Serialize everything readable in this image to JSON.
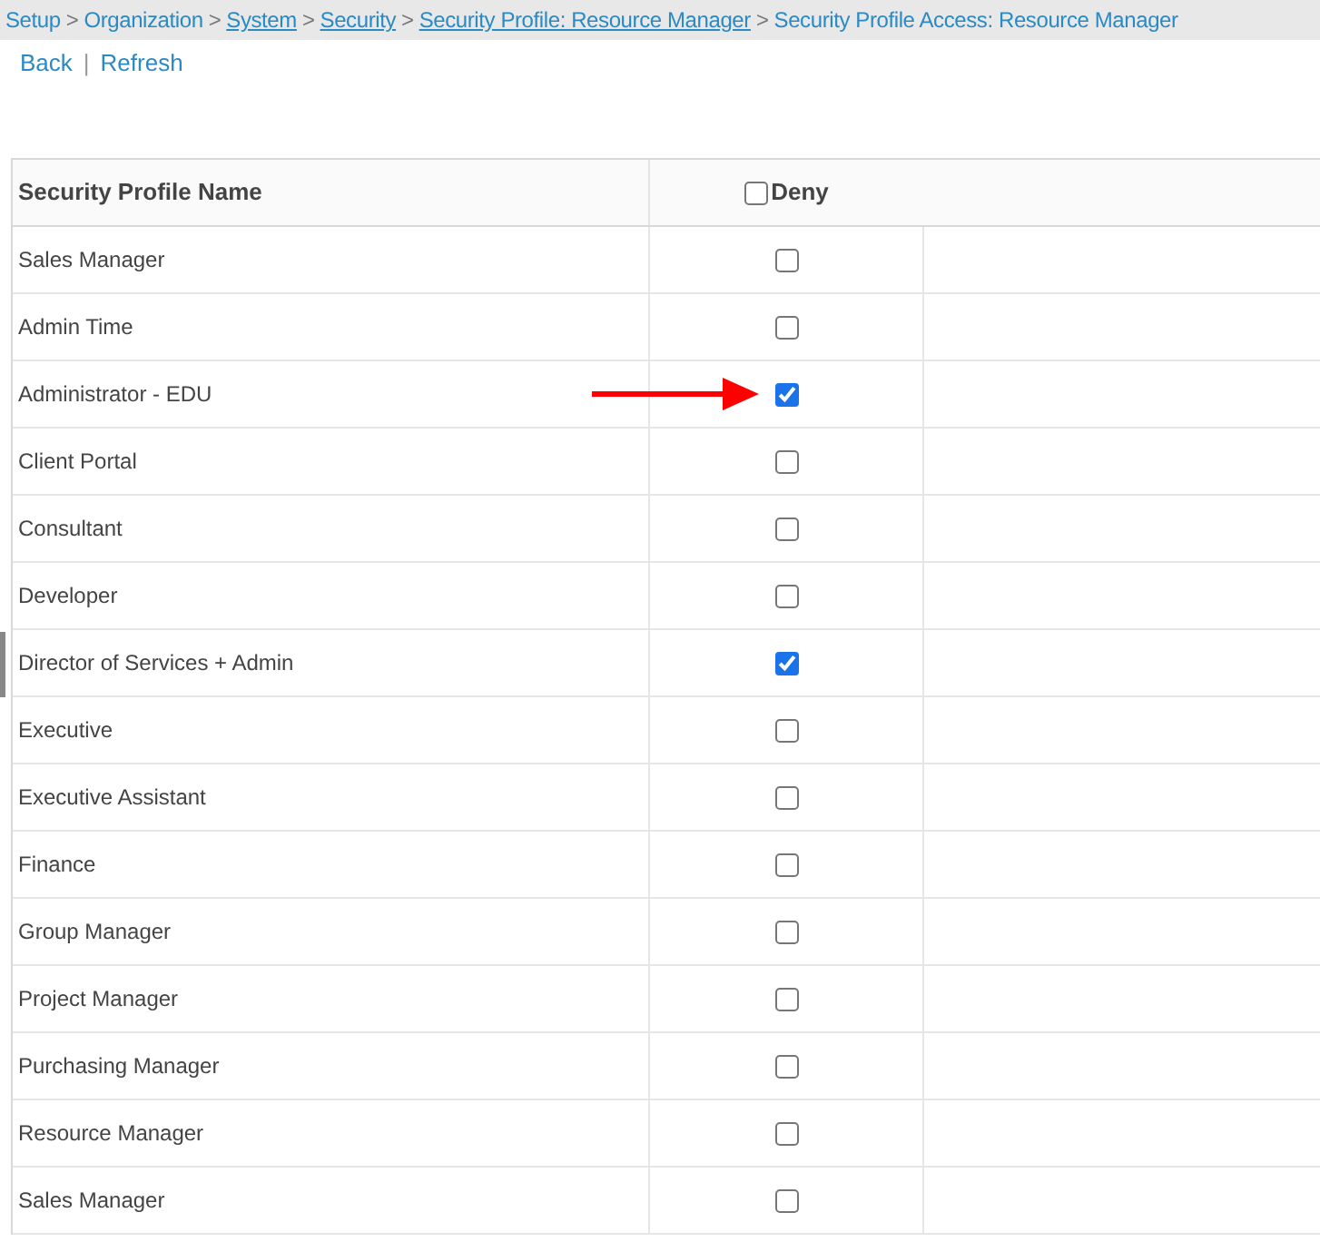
{
  "breadcrumb": [
    {
      "kind": "text",
      "label": "Setup"
    },
    {
      "kind": "separator",
      "label": ">"
    },
    {
      "kind": "text",
      "label": "Organization"
    },
    {
      "kind": "separator",
      "label": ">"
    },
    {
      "kind": "link",
      "label": "System"
    },
    {
      "kind": "separator",
      "label": ">"
    },
    {
      "kind": "link",
      "label": "Security"
    },
    {
      "kind": "separator",
      "label": ">"
    },
    {
      "kind": "link",
      "label": "Security Profile: Resource Manager"
    },
    {
      "kind": "separator",
      "label": ">"
    },
    {
      "kind": "text",
      "label": "Security Profile Access: Resource Manager"
    }
  ],
  "actions": [
    {
      "kind": "link",
      "label": "Back"
    },
    {
      "kind": "separator",
      "label": "|"
    },
    {
      "kind": "link",
      "label": "Refresh"
    }
  ],
  "table": {
    "columns": [
      {
        "label": "Security Profile Name"
      },
      {
        "label": "Deny",
        "checked": false
      }
    ],
    "rows": [
      {
        "name": "Sales Manager",
        "deny": false
      },
      {
        "name": "Admin Time",
        "deny": false
      },
      {
        "name": "Administrator - EDU",
        "deny": true,
        "annotated": true
      },
      {
        "name": "Client Portal",
        "deny": false
      },
      {
        "name": "Consultant",
        "deny": false
      },
      {
        "name": "Developer",
        "deny": false
      },
      {
        "name": "Director of Services + Admin",
        "deny": true
      },
      {
        "name": "Executive",
        "deny": false
      },
      {
        "name": "Executive Assistant",
        "deny": false
      },
      {
        "name": "Finance",
        "deny": false
      },
      {
        "name": "Group Manager",
        "deny": false
      },
      {
        "name": "Project Manager",
        "deny": false
      },
      {
        "name": "Purchasing Manager",
        "deny": false
      },
      {
        "name": "Resource Manager",
        "deny": false
      },
      {
        "name": "Sales Manager",
        "deny": false
      }
    ]
  }
}
